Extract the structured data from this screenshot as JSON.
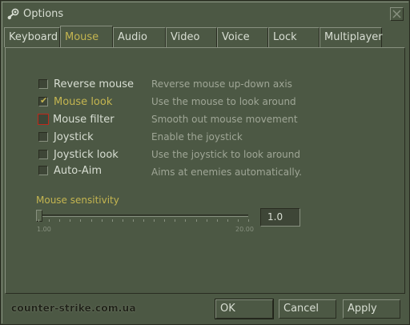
{
  "window": {
    "title": "Options"
  },
  "tabs": [
    {
      "label": "Keyboard",
      "active": false
    },
    {
      "label": "Mouse",
      "active": true
    },
    {
      "label": "Audio",
      "active": false
    },
    {
      "label": "Video",
      "active": false
    },
    {
      "label": "Voice",
      "active": false
    },
    {
      "label": "Lock",
      "active": false
    },
    {
      "label": "Multiplayer",
      "active": false
    }
  ],
  "options": [
    {
      "label": "Reverse mouse",
      "description": "Reverse mouse up-down axis",
      "checked": false
    },
    {
      "label": "Mouse look",
      "description": "Use the mouse to look around",
      "checked": true
    },
    {
      "label": "Mouse filter",
      "description": "Smooth out mouse movement",
      "checked": false,
      "focused": true
    },
    {
      "label": "Joystick",
      "description": "Enable the joystick",
      "checked": false
    },
    {
      "label": "Joystick look",
      "description": "Use the joystick to look around",
      "checked": false
    },
    {
      "label": "Auto-Aim",
      "description": "Aims at enemies automatically.",
      "checked": false
    }
  ],
  "sensitivity": {
    "label": "Mouse sensitivity",
    "min_label": "1.00",
    "max_label": "20.00",
    "value": "1.0",
    "min": 1.0,
    "max": 20.0,
    "current": 1.0
  },
  "watermark": "counter-strike.com.ua",
  "buttons": {
    "ok": "OK",
    "cancel": "Cancel",
    "apply": "Apply"
  },
  "colors": {
    "background": "#4c5844",
    "accent": "#c4b550",
    "text": "#d8ded3",
    "focus": "#c0281a"
  }
}
